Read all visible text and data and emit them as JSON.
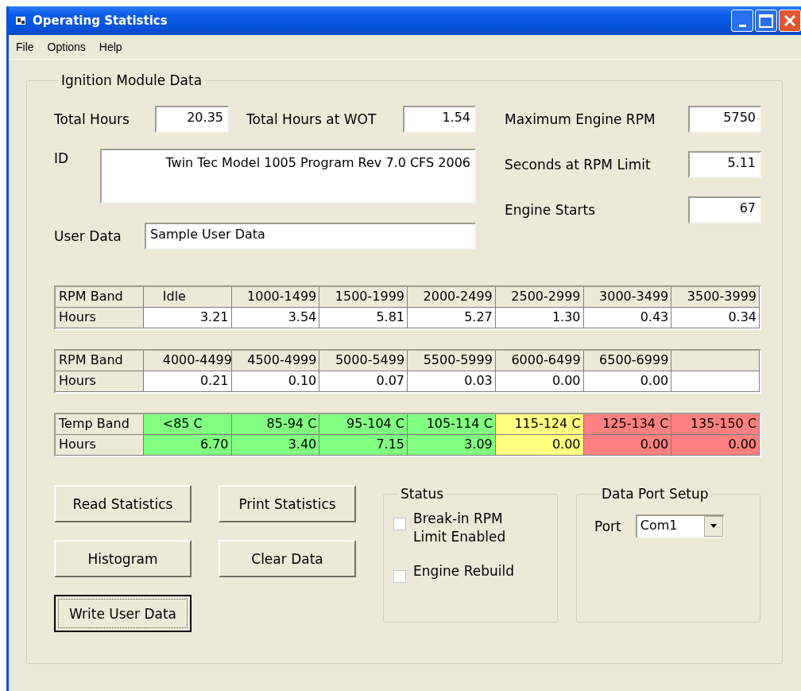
{
  "window": {
    "title": "Operating Statistics"
  },
  "menu": [
    "File",
    "Options",
    "Help"
  ],
  "group": {
    "title": "Ignition Module Data"
  },
  "fields": {
    "total_hours": {
      "label": "Total Hours",
      "value": "20.35"
    },
    "total_hours_wot": {
      "label": "Total Hours at WOT",
      "value": "1.54"
    },
    "id": {
      "label": "ID",
      "value": "Twin Tec Model 1005 Program Rev 7.0 CFS 2006"
    },
    "user_data": {
      "label": "User Data",
      "value": "Sample User Data"
    }
  },
  "right_fields": [
    {
      "label": "Maximum Engine RPM",
      "value": "5750"
    },
    {
      "label": "Seconds at RPM Limit",
      "value": "5.11"
    },
    {
      "label": "Engine Starts",
      "value": "67"
    }
  ],
  "tables": [
    {
      "header_label": "RPM Band",
      "hours_label": "Hours",
      "bands": [
        {
          "band": "Idle",
          "hours": "3.21"
        },
        {
          "band": "1000-1499",
          "hours": "3.54"
        },
        {
          "band": "1500-1999",
          "hours": "5.81"
        },
        {
          "band": "2000-2499",
          "hours": "5.27"
        },
        {
          "band": "2500-2999",
          "hours": "1.30"
        },
        {
          "band": "3000-3499",
          "hours": "0.43"
        },
        {
          "band": "3500-3999",
          "hours": "0.34"
        }
      ]
    },
    {
      "header_label": "RPM Band",
      "hours_label": "Hours",
      "bands": [
        {
          "band": "4000-4499",
          "hours": "0.21"
        },
        {
          "band": "4500-4999",
          "hours": "0.10"
        },
        {
          "band": "5000-5499",
          "hours": "0.07"
        },
        {
          "band": "5500-5999",
          "hours": "0.03"
        },
        {
          "band": "6000-6499",
          "hours": "0.00"
        },
        {
          "band": "6500-6999",
          "hours": "0.00"
        }
      ]
    },
    {
      "header_label": "Temp Band",
      "hours_label": "Hours",
      "bands": [
        {
          "band": "<85 C",
          "hours": "6.70",
          "color": "#80ff80"
        },
        {
          "band": "85-94 C",
          "hours": "3.40",
          "color": "#80ff80"
        },
        {
          "band": "95-104 C",
          "hours": "7.15",
          "color": "#80ff80"
        },
        {
          "band": "105-114 C",
          "hours": "3.09",
          "color": "#80ff80"
        },
        {
          "band": "115-124 C",
          "hours": "0.00",
          "color": "#ffff80"
        },
        {
          "band": "125-134 C",
          "hours": "0.00",
          "color": "#ff8080"
        },
        {
          "band": "135-150 C",
          "hours": "0.00",
          "color": "#ff8080"
        }
      ]
    }
  ],
  "buttons": [
    {
      "label": "Read Statistics",
      "default": false
    },
    {
      "label": "Print Statistics",
      "default": false
    },
    {
      "label": "Histogram",
      "default": false
    },
    {
      "label": "Clear Data",
      "default": false
    },
    {
      "label": "Write User Data",
      "default": true
    }
  ],
  "status": {
    "title": "Status",
    "checkboxes": [
      {
        "label": "Break-in RPM Limit Enabled",
        "checked": false
      },
      {
        "label": "Engine Rebuild",
        "checked": false
      }
    ]
  },
  "data_port": {
    "title": "Data Port Setup",
    "port_label": "Port",
    "port_value": "Com1"
  }
}
